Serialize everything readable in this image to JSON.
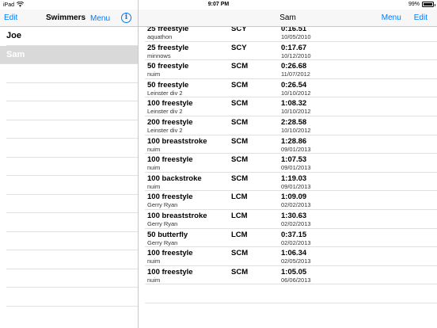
{
  "status_bar": {
    "device": "iPad",
    "wifi_icon": "wifi-icon",
    "time": "9:07 PM",
    "battery_percent": "99%",
    "battery_level": 0.99
  },
  "master": {
    "edit_label": "Edit",
    "title": "Swimmers",
    "menu_label": "Menu",
    "info_icon": "info-icon",
    "swimmers": [
      {
        "name": "Joe",
        "selected": false
      },
      {
        "name": "Sam",
        "selected": true
      }
    ]
  },
  "detail": {
    "title": "Sam",
    "menu_label": "Menu",
    "edit_label": "Edit",
    "results": [
      {
        "event": "25 freestyle",
        "meet": "aquathon",
        "course": "SCY",
        "time": "0:16.51",
        "date": "10/05/2010"
      },
      {
        "event": "25 freestyle",
        "meet": "minnows",
        "course": "SCY",
        "time": "0:17.67",
        "date": "10/12/2010"
      },
      {
        "event": "50 freestyle",
        "meet": "nuim",
        "course": "SCM",
        "time": "0:26.68",
        "date": "11/07/2012"
      },
      {
        "event": "50 freestyle",
        "meet": "Leinster div 2",
        "course": "SCM",
        "time": "0:26.54",
        "date": "10/10/2012"
      },
      {
        "event": "100 freestyle",
        "meet": "Leinster div 2",
        "course": "SCM",
        "time": "1:08.32",
        "date": "10/10/2012"
      },
      {
        "event": "200 freestyle",
        "meet": "Leinster div 2",
        "course": "SCM",
        "time": "2:28.58",
        "date": "10/10/2012"
      },
      {
        "event": "100 breaststroke",
        "meet": "nuim",
        "course": "SCM",
        "time": "1:28.86",
        "date": "09/01/2013"
      },
      {
        "event": "100 freestyle",
        "meet": "nuim",
        "course": "SCM",
        "time": "1:07.53",
        "date": "09/01/2013"
      },
      {
        "event": "100 backstroke",
        "meet": "nuim",
        "course": "SCM",
        "time": "1:19.03",
        "date": "09/01/2013"
      },
      {
        "event": "100 freestyle",
        "meet": "Gerry Ryan",
        "course": "LCM",
        "time": "1:09.09",
        "date": "02/02/2013"
      },
      {
        "event": "100 breaststroke",
        "meet": "Gerry Ryan",
        "course": "LCM",
        "time": "1:30.63",
        "date": "02/02/2013"
      },
      {
        "event": "50 butterfly",
        "meet": "Gerry Ryan",
        "course": "LCM",
        "time": "0:37.15",
        "date": "02/02/2013"
      },
      {
        "event": "100 freestyle",
        "meet": "nuim",
        "course": "SCM",
        "time": "1:06.34",
        "date": "02/05/2013"
      },
      {
        "event": "100 freestyle",
        "meet": "nuim",
        "course": "SCM",
        "time": "1:05.05",
        "date": "06/06/2013"
      }
    ]
  },
  "colors": {
    "accent": "#007aff",
    "selected_row": "#d9d9d9",
    "separator": "#e0e0e0"
  }
}
